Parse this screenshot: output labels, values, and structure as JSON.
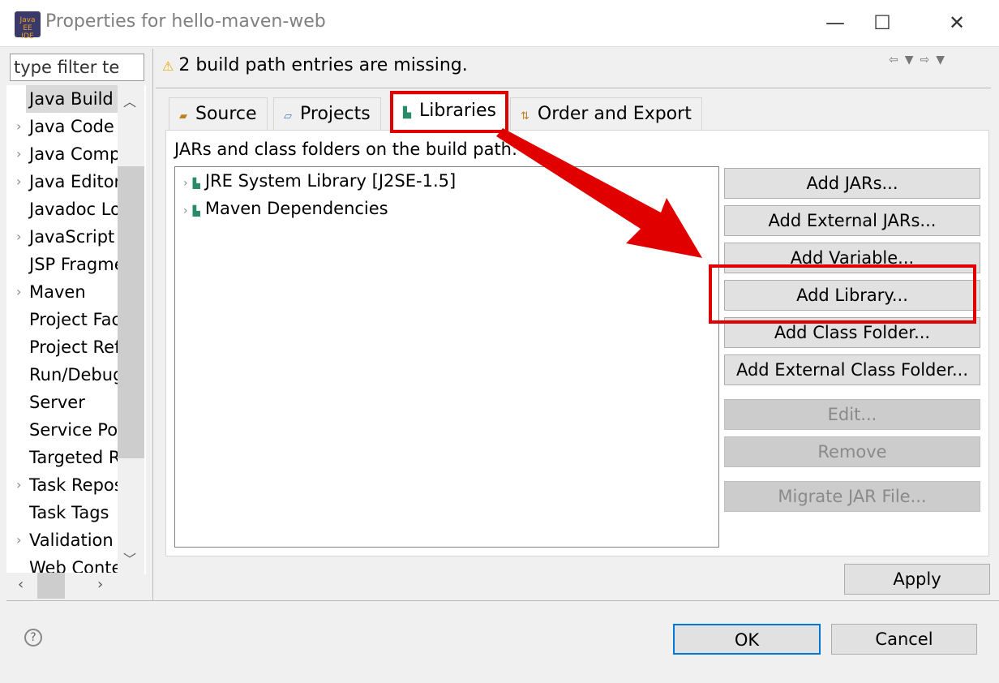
{
  "window": {
    "title": "Properties for hello-maven-web",
    "app_icon": "Java EE IDE",
    "minimize": "—",
    "maximize": "☐",
    "close": "✕"
  },
  "filter": {
    "placeholder": "type filter text",
    "value": "type filter te"
  },
  "tree": {
    "items": [
      {
        "label": "Java Build Path",
        "expandable": false,
        "selected": true
      },
      {
        "label": "Java Code Style",
        "expandable": true
      },
      {
        "label": "Java Compiler",
        "expandable": true
      },
      {
        "label": "Java Editor",
        "expandable": true
      },
      {
        "label": "Javadoc Location",
        "expandable": false
      },
      {
        "label": "JavaScript",
        "expandable": true
      },
      {
        "label": "JSP Fragment",
        "expandable": false
      },
      {
        "label": "Maven",
        "expandable": true
      },
      {
        "label": "Project Facets",
        "expandable": false
      },
      {
        "label": "Project References",
        "expandable": false
      },
      {
        "label": "Run/Debug Settings",
        "expandable": false
      },
      {
        "label": "Server",
        "expandable": false
      },
      {
        "label": "Service Policies",
        "expandable": false
      },
      {
        "label": "Targeted Runtimes",
        "expandable": false
      },
      {
        "label": "Task Repository",
        "expandable": true
      },
      {
        "label": "Task Tags",
        "expandable": false
      },
      {
        "label": "Validation",
        "expandable": true
      },
      {
        "label": "Web Content Settings",
        "expandable": false
      }
    ]
  },
  "header": {
    "warning": "2 build path entries are missing.",
    "icon": "warning-icon"
  },
  "tabs": [
    {
      "label": "Source"
    },
    {
      "label": "Projects"
    },
    {
      "label": "Libraries",
      "active": true
    },
    {
      "label": "Order and Export"
    }
  ],
  "panel": {
    "label": "JARs and class folders on the build path:",
    "entries": [
      {
        "label": "JRE System Library [J2SE-1.5]"
      },
      {
        "label": "Maven Dependencies"
      }
    ]
  },
  "buttons": [
    {
      "label": "Add JARs...",
      "enabled": true
    },
    {
      "label": "Add External JARs...",
      "enabled": true
    },
    {
      "label": "Add Variable...",
      "enabled": true
    },
    {
      "label": "Add Library...",
      "enabled": true
    },
    {
      "label": "Add Class Folder...",
      "enabled": true
    },
    {
      "label": "Add External Class Folder...",
      "enabled": true
    },
    {
      "label": "Edit...",
      "enabled": false
    },
    {
      "label": "Remove",
      "enabled": false
    },
    {
      "label": "Migrate JAR File...",
      "enabled": false
    }
  ],
  "footer": {
    "apply": "Apply",
    "ok": "OK",
    "cancel": "Cancel",
    "help": "?"
  },
  "annotation_color": "#e00000"
}
